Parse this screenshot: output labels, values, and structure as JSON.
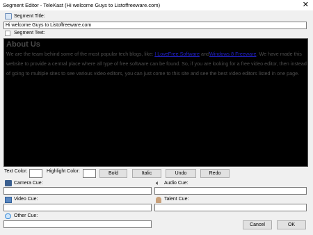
{
  "window": {
    "title": "Segment Editor - TeleKast (Hi welcome Guys to Listoffreeware.com)",
    "close_glyph": "✕"
  },
  "segment_title": {
    "label": "Segment Title:",
    "value": "Hi welcome Guys to Listoffreeware.com"
  },
  "segment_text": {
    "label": "Segment Text:",
    "heading": "About Us",
    "p1": "We are the team behind some of the most popular tech blogs, like: ",
    "link1": "I LoveFree Software",
    "p2": " and",
    "link2": "Windows 8 Freeware",
    "p3": ". We have made this website to provide a central place where all type of free software can be found. So, if you are looking for a free video editor, then instead of going to multiple sites to see various video editors, you can just come to this site and see the best video editors listed in one page."
  },
  "formatting": {
    "text_color_label": "Text Color:",
    "highlight_color_label": "Highlight Color:",
    "bold": "Bold",
    "italic": "Italic",
    "undo": "Undo",
    "redo": "Redo"
  },
  "cues": {
    "camera": {
      "label": "Camera Cue:",
      "value": ""
    },
    "audio": {
      "label": "Audio Cue:",
      "value": ""
    },
    "video": {
      "label": "Video Cue:",
      "value": ""
    },
    "talent": {
      "label": "Talent Cue:",
      "value": ""
    },
    "other": {
      "label": "Other Cue:",
      "value": ""
    }
  },
  "actions": {
    "cancel": "Cancel",
    "ok": "OK"
  },
  "colors": {
    "editor_bg": "#000000",
    "link": "#2222cc",
    "text": "#4f4f4f",
    "window_bg": "#f0f0f0"
  },
  "icons": {
    "segment_title": "document-icon",
    "segment_text": "text-icon",
    "camera": "camera-icon",
    "audio": "speaker-icon",
    "video": "film-icon",
    "talent": "person-icon",
    "other": "speech-bubble-icon"
  }
}
